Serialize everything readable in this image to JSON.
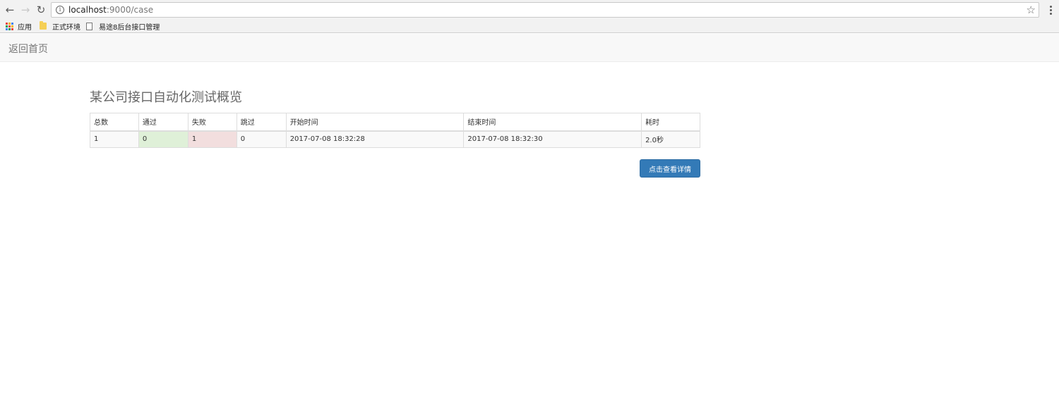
{
  "browser": {
    "url_host": "localhost",
    "url_path": ":9000/case",
    "back_glyph": "←",
    "forward_glyph": "→",
    "reload_glyph": "↻",
    "star_glyph": "☆",
    "info_glyph": "i"
  },
  "bookmarks": {
    "apps_label": "应用",
    "items": [
      "正式环境",
      "易途8后台接口管理"
    ]
  },
  "navbar": {
    "brand": "返回首页"
  },
  "main": {
    "title": "某公司接口自动化测试概览",
    "table": {
      "headers": [
        "总数",
        "通过",
        "失败",
        "跳过",
        "开始时间",
        "结束时间",
        "耗时"
      ],
      "row": [
        "1",
        "0",
        "1",
        "0",
        "2017-07-08 18:32:28",
        "2017-07-08 18:32:30",
        "2.0秒"
      ]
    },
    "details_button": "点击查看详情"
  },
  "colors": {
    "pass_bg": "#dff0d8",
    "fail_bg": "#f2dede",
    "primary": "#337ab7"
  }
}
